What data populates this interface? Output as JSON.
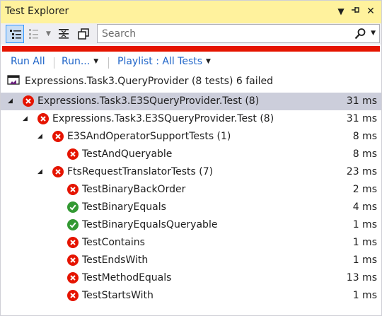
{
  "window": {
    "title": "Test Explorer",
    "menu_icon": "dropdown-arrow-icon",
    "pin_icon": "pin-icon",
    "close_icon": "close-icon"
  },
  "toolbar": {
    "buttons": [
      {
        "name": "group-by-icon",
        "active": true
      },
      {
        "name": "group-by-class-icon",
        "active": false
      },
      {
        "name": "expand-collapse-icon",
        "active": false
      },
      {
        "name": "copy-icon",
        "active": false
      }
    ],
    "search": {
      "placeholder": "Search",
      "value": ""
    }
  },
  "progress_color": "#e51400",
  "commands": {
    "run_all": "Run All",
    "run": "Run...",
    "playlist": "Playlist : All Tests"
  },
  "summary": {
    "text": "Expressions.Task3.QueryProvider (8 tests) 6 failed"
  },
  "colors": {
    "failed": "#e51400",
    "passed": "#339933",
    "selected_row": "#cccedb",
    "link": "#1e64c8"
  },
  "tree": [
    {
      "label": "Expressions.Task3.E3SQueryProvider.Test (8)",
      "duration": "31 ms",
      "status": "failed",
      "depth": 0,
      "expandable": true,
      "selected": true
    },
    {
      "label": "Expressions.Task3.E3SQueryProvider.Test (8)",
      "duration": "31 ms",
      "status": "failed",
      "depth": 1,
      "expandable": true,
      "selected": false
    },
    {
      "label": "E3SAndOperatorSupportTests (1)",
      "duration": "8 ms",
      "status": "failed",
      "depth": 2,
      "expandable": true,
      "selected": false
    },
    {
      "label": "TestAndQueryable",
      "duration": "8 ms",
      "status": "failed",
      "depth": 3,
      "expandable": false,
      "selected": false
    },
    {
      "label": "FtsRequestTranslatorTests (7)",
      "duration": "23 ms",
      "status": "failed",
      "depth": 2,
      "expandable": true,
      "selected": false
    },
    {
      "label": "TestBinaryBackOrder",
      "duration": "2 ms",
      "status": "failed",
      "depth": 3,
      "expandable": false,
      "selected": false
    },
    {
      "label": "TestBinaryEquals",
      "duration": "4 ms",
      "status": "passed",
      "depth": 3,
      "expandable": false,
      "selected": false
    },
    {
      "label": "TestBinaryEqualsQueryable",
      "duration": "1 ms",
      "status": "passed",
      "depth": 3,
      "expandable": false,
      "selected": false
    },
    {
      "label": "TestContains",
      "duration": "1 ms",
      "status": "failed",
      "depth": 3,
      "expandable": false,
      "selected": false
    },
    {
      "label": "TestEndsWith",
      "duration": "1 ms",
      "status": "failed",
      "depth": 3,
      "expandable": false,
      "selected": false
    },
    {
      "label": "TestMethodEquals",
      "duration": "13 ms",
      "status": "failed",
      "depth": 3,
      "expandable": false,
      "selected": false
    },
    {
      "label": "TestStartsWith",
      "duration": "1 ms",
      "status": "failed",
      "depth": 3,
      "expandable": false,
      "selected": false
    }
  ]
}
